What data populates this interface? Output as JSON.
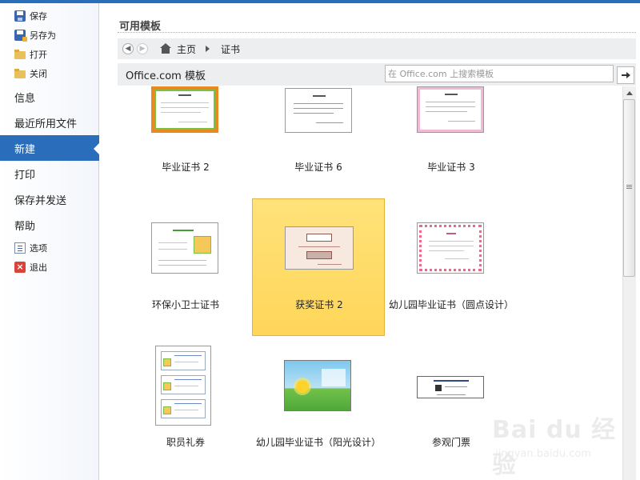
{
  "sidebar": {
    "small_top": [
      {
        "label": "保存",
        "icon": "save-icon"
      },
      {
        "label": "另存为",
        "icon": "save-as-icon"
      },
      {
        "label": "打开",
        "icon": "open-folder-icon"
      },
      {
        "label": "关闭",
        "icon": "close-folder-icon"
      }
    ],
    "big": [
      {
        "label": "信息"
      },
      {
        "label": "最近所用文件"
      },
      {
        "label": "新建",
        "active": true
      },
      {
        "label": "打印"
      },
      {
        "label": "保存并发送"
      },
      {
        "label": "帮助"
      }
    ],
    "small_bottom": [
      {
        "label": "选项",
        "icon": "options-icon"
      },
      {
        "label": "退出",
        "icon": "exit-icon"
      }
    ]
  },
  "main": {
    "section_title": "可用模板",
    "breadcrumb": {
      "home": "主页",
      "current": "证书"
    },
    "office": {
      "title": "Office.com 模板",
      "search_placeholder": "在 Office.com 上搜索模板"
    },
    "templates": [
      {
        "name": "毕业证书 2"
      },
      {
        "name": "毕业证书 6"
      },
      {
        "name": "毕业证书 3"
      },
      {
        "name": "环保小卫士证书"
      },
      {
        "name": "获奖证书 2",
        "selected": true
      },
      {
        "name": "幼儿园毕业证书（圆点设计）"
      },
      {
        "name": "职员礼券"
      },
      {
        "name": "幼儿园毕业证书（阳光设计）"
      },
      {
        "name": "参观门票"
      }
    ]
  },
  "watermark": {
    "top": "Bai du 经验",
    "bottom": "jingyan.baidu.com"
  },
  "colors": {
    "accent": "#2a6ebb",
    "selected": "#ffd659"
  }
}
